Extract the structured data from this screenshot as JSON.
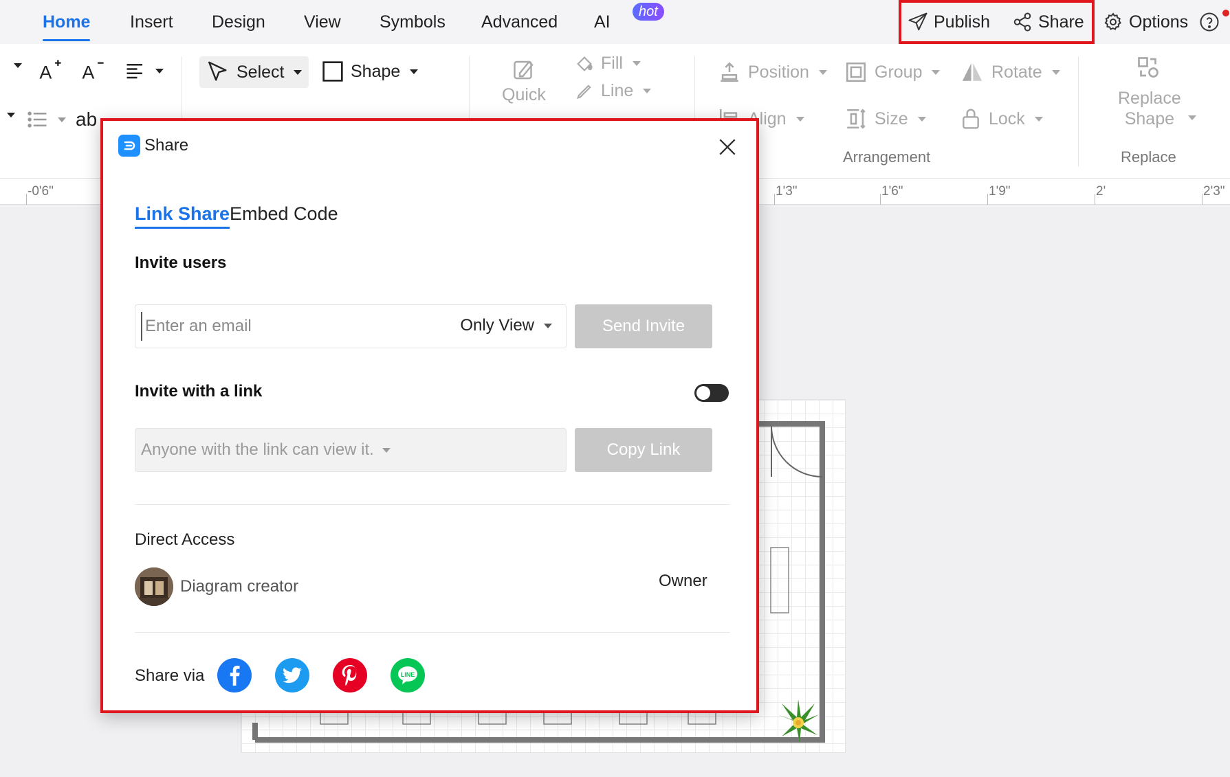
{
  "nav": {
    "tabs": [
      "Home",
      "Insert",
      "Design",
      "View",
      "Symbols",
      "Advanced",
      "AI"
    ],
    "hot_badge": "hot",
    "publish_label": "Publish",
    "share_label": "Share",
    "options_label": "Options"
  },
  "ribbon": {
    "select_label": "Select",
    "shape_label": "Shape",
    "quick_label": "Quick",
    "fill_label": "Fill",
    "line_label": "Line",
    "position_label": "Position",
    "group_label": "Group",
    "rotate_label": "Rotate",
    "align_label": "Align",
    "size_label": "Size",
    "lock_label": "Lock",
    "arrangement_label": "Arrangement",
    "replace_shape_label_1": "Replace",
    "replace_shape_label_2": "Shape",
    "replace_group_label": "Replace",
    "text_ab": "ab"
  },
  "ruler": {
    "ticks": [
      "-0'6\"",
      "1'3\"",
      "1'6\"",
      "1'9\"",
      "2'",
      "2'3\""
    ]
  },
  "dialog": {
    "title": "Share",
    "tabs": [
      "Link Share",
      "Embed Code"
    ],
    "invite_users_title": "Invite users",
    "email_placeholder": "Enter an email",
    "permission_value": "Only View",
    "send_invite_label": "Send Invite",
    "invite_link_title": "Invite with a link",
    "link_permission_value": "Anyone with the link can view it.",
    "copy_link_label": "Copy Link",
    "direct_access_label": "Direct Access",
    "user_name": "Diagram creator",
    "user_role": "Owner",
    "share_via_label": "Share via",
    "toggle_on": false
  },
  "colors": {
    "accent": "#1a73e8",
    "highlight": "#e0161f",
    "facebook": "#1877f2",
    "twitter": "#1d9bf0",
    "pinterest": "#e60023",
    "line": "#06c755"
  }
}
